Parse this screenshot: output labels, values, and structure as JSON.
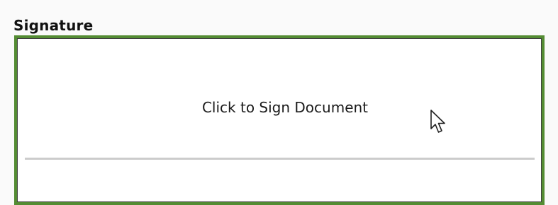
{
  "signature": {
    "label": "Signature",
    "prompt": "Click to Sign Document"
  },
  "colors": {
    "border": "#548c33",
    "signature_line": "#cccccc",
    "page_background": "#fafafa"
  },
  "icons": {
    "pointer": "mouse-pointer-arrow-icon"
  }
}
